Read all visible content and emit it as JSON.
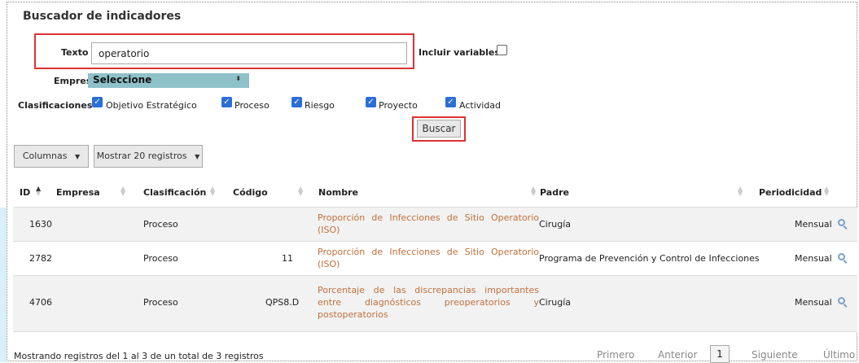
{
  "title": "Buscador de indicadores",
  "search": {
    "texto_label": "Texto",
    "texto_value": "operatorio",
    "incluir_label": "Incluir variables",
    "empresa_label": "Empresa",
    "empresa_value": "Seleccione",
    "clasificaciones_label": "Clasificaciones",
    "checks": [
      "Objetivo Estratégico",
      "Proceso",
      "Riesgo",
      "Proyecto",
      "Actividad"
    ],
    "buscar_label": "Buscar"
  },
  "toolbar": {
    "columnas_label": "Columnas",
    "mostrar_label": "Mostrar 20 registros"
  },
  "table": {
    "headers": [
      "ID",
      "Empresa",
      "Clasificación",
      "Código",
      "Nombre",
      "Padre",
      "Periodicidad"
    ],
    "rows": [
      {
        "id": "1630",
        "empresa": "",
        "clasificacion": "Proceso",
        "codigo": "",
        "nombre": "Proporción de Infecciones de Sitio Operatorio (ISO)",
        "padre": "Cirugía",
        "periodicidad": "Mensual"
      },
      {
        "id": "2782",
        "empresa": "",
        "clasificacion": "Proceso",
        "codigo": "11",
        "nombre": "Proporción de Infecciones de Sitio Operatorio (ISO)",
        "padre": "Programa de Prevención y Control de Infecciones",
        "periodicidad": "Mensual"
      },
      {
        "id": "4706",
        "empresa": "",
        "clasificacion": "Proceso",
        "codigo": "QPS8.D",
        "nombre": "Porcentaje de las discrepancias importantes entre diagnósticos preoperatorios y postoperatorios",
        "padre": "Cirugía",
        "periodicidad": "Mensual"
      }
    ]
  },
  "footer": {
    "info": "Mostrando registros del 1 al 3 de un total de 3 registros",
    "primero": "Primero",
    "anterior": "Anterior",
    "page": "1",
    "siguiente": "Siguiente",
    "ultimo": "Último"
  }
}
